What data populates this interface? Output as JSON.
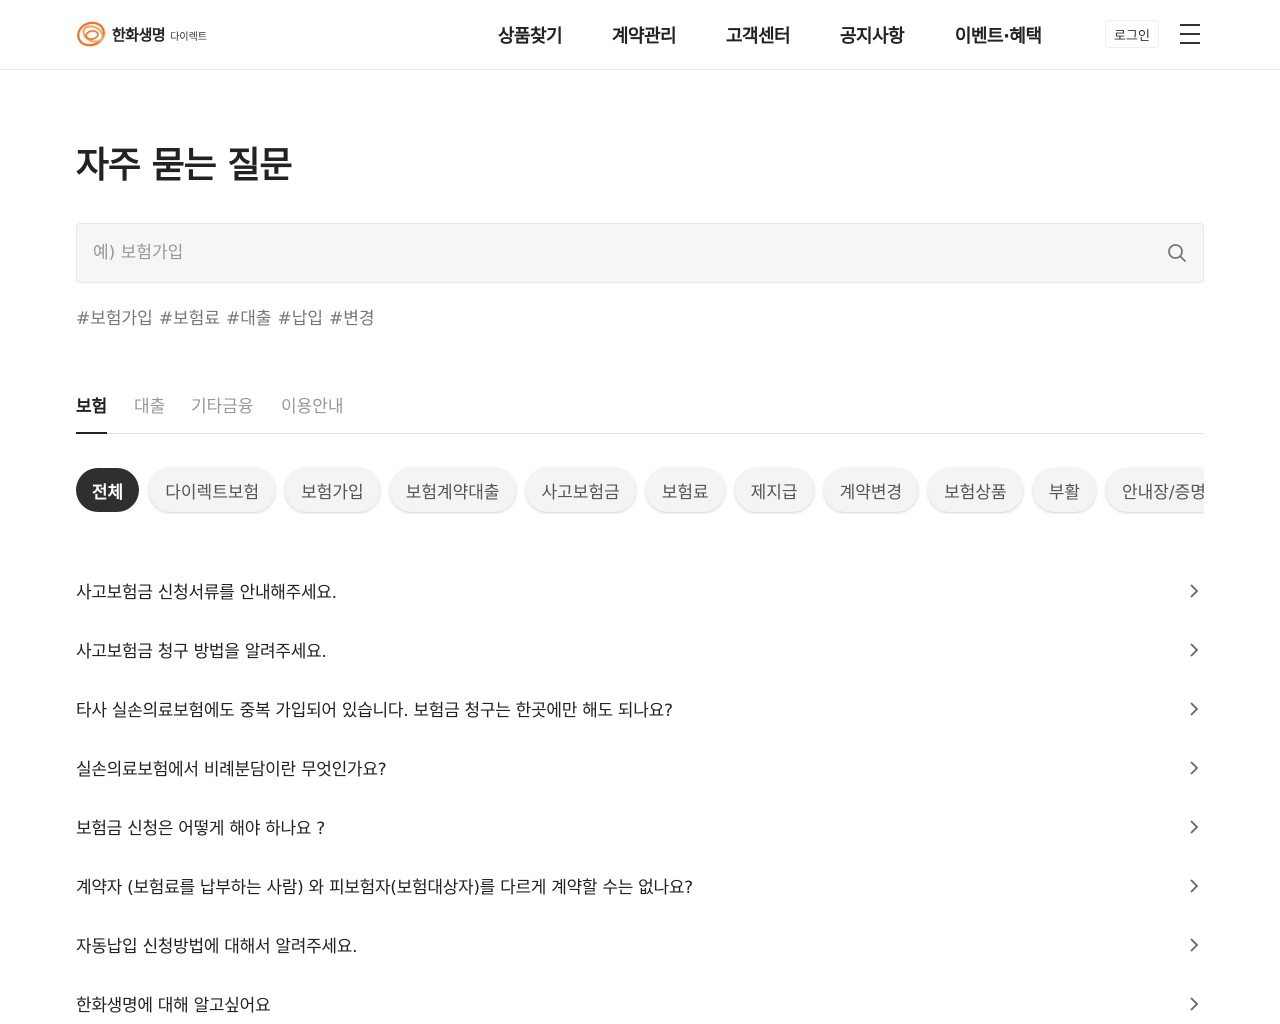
{
  "header": {
    "logo_text": "한화생명",
    "logo_sub": "다이렉트",
    "nav": [
      {
        "label": "상품찾기"
      },
      {
        "label": "계약관리"
      },
      {
        "label": "고객센터"
      },
      {
        "label": "공지사항"
      },
      {
        "label": "이벤트·혜택"
      }
    ],
    "login_label": "로그인"
  },
  "page": {
    "title": "자주 묻는 질문"
  },
  "search": {
    "placeholder": "예) 보험가입",
    "value": ""
  },
  "hashtags": [
    "#보험가입",
    "#보험료",
    "#대출",
    "#납입",
    "#변경"
  ],
  "tabs": [
    {
      "label": "보험",
      "active": true
    },
    {
      "label": "대출",
      "active": false
    },
    {
      "label": "기타금융",
      "active": false
    },
    {
      "label": "이용안내",
      "active": false
    }
  ],
  "chips": [
    {
      "label": "전체",
      "active": true
    },
    {
      "label": "다이렉트보험",
      "active": false
    },
    {
      "label": "보험가입",
      "active": false
    },
    {
      "label": "보험계약대출",
      "active": false
    },
    {
      "label": "사고보험금",
      "active": false
    },
    {
      "label": "보험료",
      "active": false
    },
    {
      "label": "제지급",
      "active": false
    },
    {
      "label": "계약변경",
      "active": false
    },
    {
      "label": "보험상품",
      "active": false
    },
    {
      "label": "부활",
      "active": false
    },
    {
      "label": "안내장/증명서",
      "active": false
    }
  ],
  "faq": [
    {
      "question": "사고보험금 신청서류를 안내해주세요."
    },
    {
      "question": "사고보험금 청구 방법을 알려주세요."
    },
    {
      "question": "타사 실손의료보험에도 중복 가입되어 있습니다. 보험금 청구는 한곳에만 해도 되나요?"
    },
    {
      "question": "실손의료보험에서 비례분담이란 무엇인가요?"
    },
    {
      "question": "보험금 신청은 어떻게 해야 하나요 ?"
    },
    {
      "question": "계약자 (보험료를 납부하는 사람) 와 피보험자(보험대상자)를 다르게 계약할 수는 없나요?"
    },
    {
      "question": "자동납입 신청방법에 대해서 알려주세요."
    },
    {
      "question": "한화생명에 대해 알고싶어요"
    }
  ],
  "colors": {
    "brand_orange": "#f37321",
    "text_dark": "#222222",
    "chip_active_bg": "#2f2f2f",
    "chip_bg": "#f4f4f4",
    "search_bg": "#f6f6f6"
  },
  "icons": {
    "search": "search-icon",
    "menu": "hamburger-menu-icon",
    "chevron": "chevron-right-icon"
  }
}
